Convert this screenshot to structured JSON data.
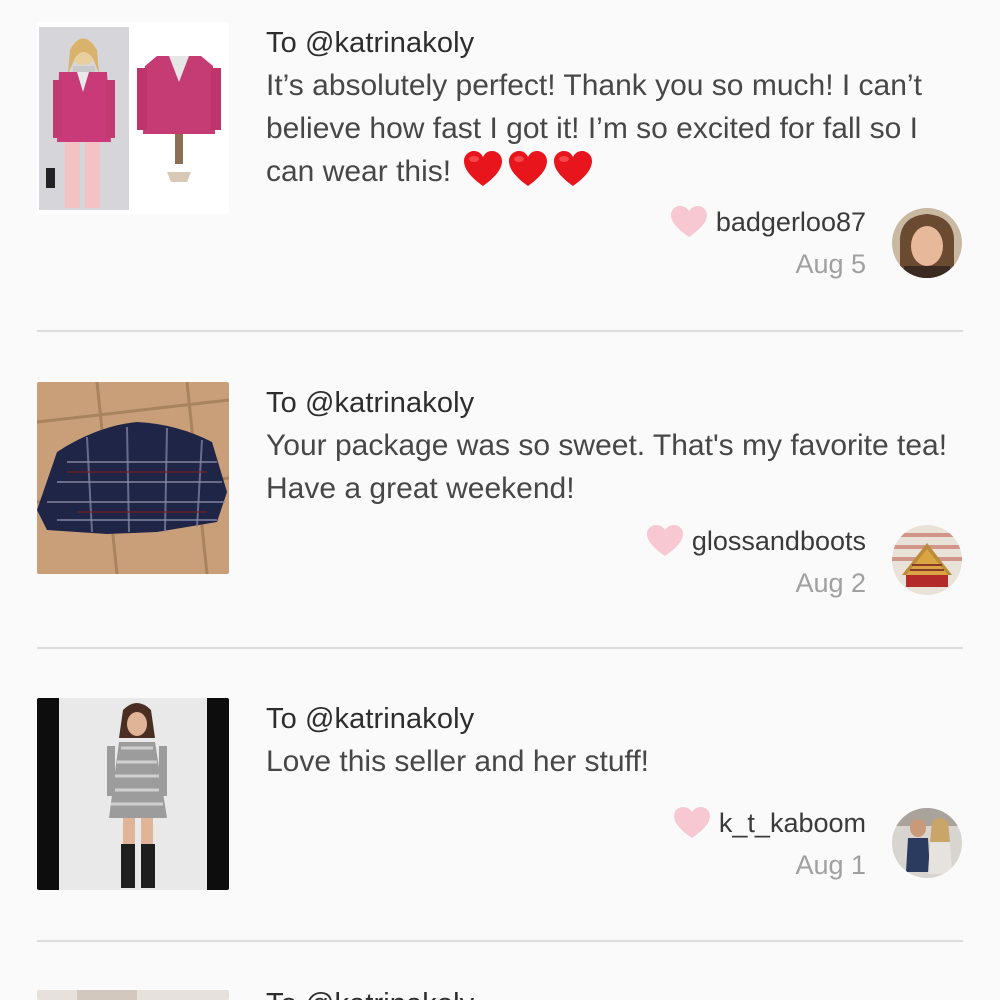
{
  "feed": {
    "items": [
      {
        "to": "To @katrinakoly",
        "message": "It’s absolutely perfect! Thank you so much! I can’t believe how fast I got it! I’m so excited for fall so I can wear this!",
        "emoji_count": 3,
        "username": "badgerloo87",
        "date": "Aug 5",
        "image": "pink tweed jacket listing photo"
      },
      {
        "to": "To @katrinakoly",
        "message": "Your package was so sweet. That's my favorite tea! Have a great weekend!",
        "username": "glossandboots",
        "date": "Aug 2",
        "image": "navy plaid shirt listing photo"
      },
      {
        "to": "To @katrinakoly",
        "message": "Love this seller and her stuff!",
        "username": "k_t_kaboom",
        "date": "Aug 1",
        "image": "gray dress listing photo"
      }
    ],
    "partial_next": {
      "to": "To @katrinakoly"
    }
  },
  "colors": {
    "background": "#fbfafb",
    "like_heart": "#f7c8d1",
    "emoji_heart": "#e8151c",
    "divider": "#dcdcdc",
    "muted_text": "#a0a0a0"
  },
  "icons": {
    "like": "heart-outline-pink-icon",
    "emoji": "red-heart-emoji-icon"
  }
}
